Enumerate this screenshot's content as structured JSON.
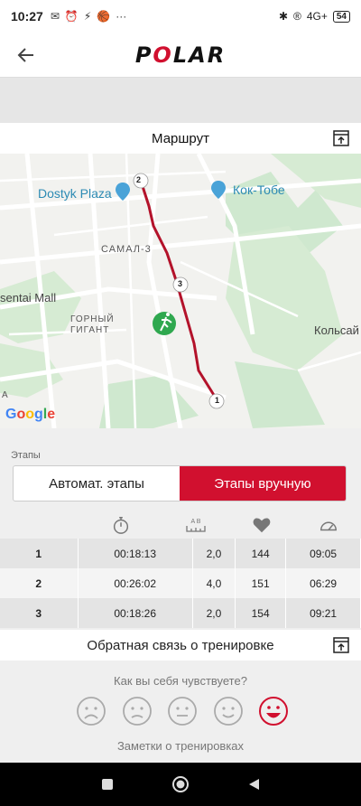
{
  "status": {
    "time": "10:27",
    "left_icons": [
      "✉",
      "⏰",
      "⚡",
      "🏀",
      "···"
    ],
    "right_icons": [
      "✱",
      "®",
      "4G+",
      "▮"
    ],
    "battery": "54"
  },
  "header": {
    "logo": "POLAR"
  },
  "route": {
    "title": "Маршрут"
  },
  "map": {
    "labels": {
      "dostyk": "Dostyk Plaza",
      "koktobe": "Кок-Тобе",
      "samal": "САМАЛ-3",
      "mall": "sentai Mall",
      "gornyi1": "ГОРНЫЙ",
      "gornyi2": "ГИГАНТ",
      "kolsai": "Кольсай",
      "a": "А"
    },
    "markers": [
      "1",
      "2",
      "3"
    ],
    "google": [
      "G",
      "o",
      "o",
      "g",
      "l",
      "e"
    ]
  },
  "stages": {
    "label": "Этапы",
    "auto": "Автомат. этапы",
    "manual": "Этапы вручную",
    "ab": "A B"
  },
  "laps": [
    {
      "num": "1",
      "time": "00:18:13",
      "dist": "2,0",
      "hr": "144",
      "pace": "09:05"
    },
    {
      "num": "2",
      "time": "00:26:02",
      "dist": "4,0",
      "hr": "151",
      "pace": "06:29"
    },
    {
      "num": "3",
      "time": "00:18:26",
      "dist": "2,0",
      "hr": "154",
      "pace": "09:21"
    }
  ],
  "feedback": {
    "title": "Обратная связь о тренировке",
    "question": "Как вы себя чувствуете?",
    "notes": "Заметки о тренировках"
  },
  "colors": {
    "accent": "#d1102f",
    "route": "#b3122a",
    "runner": "#2fa84f"
  }
}
